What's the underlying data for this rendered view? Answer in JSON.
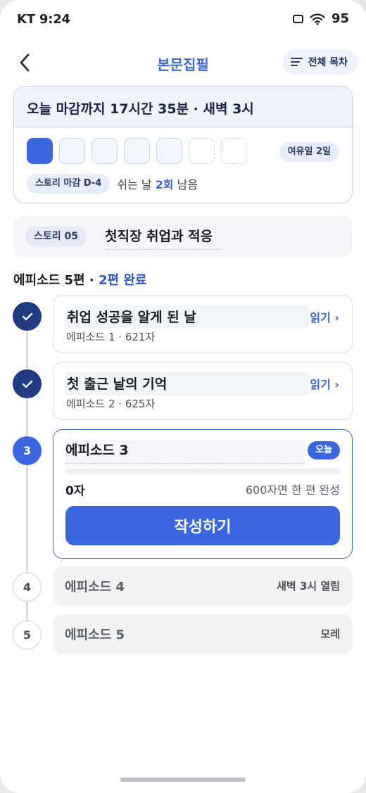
{
  "status_bar": {
    "carrier_time": "KT 9:24",
    "battery": "95"
  },
  "header": {
    "title": "본문집필",
    "toc_label": "전체 목차"
  },
  "deadline": {
    "headline": "오늘 마감까지 17시간 35분 · 새벽 3시",
    "days_filled": 1,
    "days_remaining_outline": 4,
    "days_rest_dashed": 2,
    "spare_badge": "여유일 2일",
    "story_deadline_badge": "스토리 마감 D-4",
    "rest_prefix": "쉬는 날",
    "rest_count": "2회",
    "rest_suffix": "남음"
  },
  "story": {
    "chip": "스토리 05",
    "title": "첫직장 취업과 적응"
  },
  "episodes_summary": {
    "prefix": "에피소드 5편 · ",
    "accent": "2편 완료"
  },
  "episodes": [
    {
      "number": "1",
      "title": "취업 성공을 알게 된 날",
      "meta": "에피소드 1 · 621자",
      "action": "읽기 ›"
    },
    {
      "number": "2",
      "title": "첫 출근 날의 기억",
      "meta": "에피소드 2 · 625자",
      "action": "읽기 ›"
    },
    {
      "number": "3",
      "title": "에피소드 3",
      "badge": "오늘",
      "char_count": "0자",
      "goal": "600자면 한 편 완성",
      "progress": 0,
      "button": "작성하기"
    },
    {
      "number": "4",
      "title": "에피소드 4",
      "note": "새벽 3시 열림"
    },
    {
      "number": "5",
      "title": "에피소드 5",
      "note": "모레"
    }
  ],
  "colors": {
    "accent": "#3c66e0",
    "done_node": "#223c84"
  },
  "icons": [
    "back-arrow-icon",
    "list-icon",
    "check-icon",
    "wifi-icon",
    "screen-icon"
  ]
}
